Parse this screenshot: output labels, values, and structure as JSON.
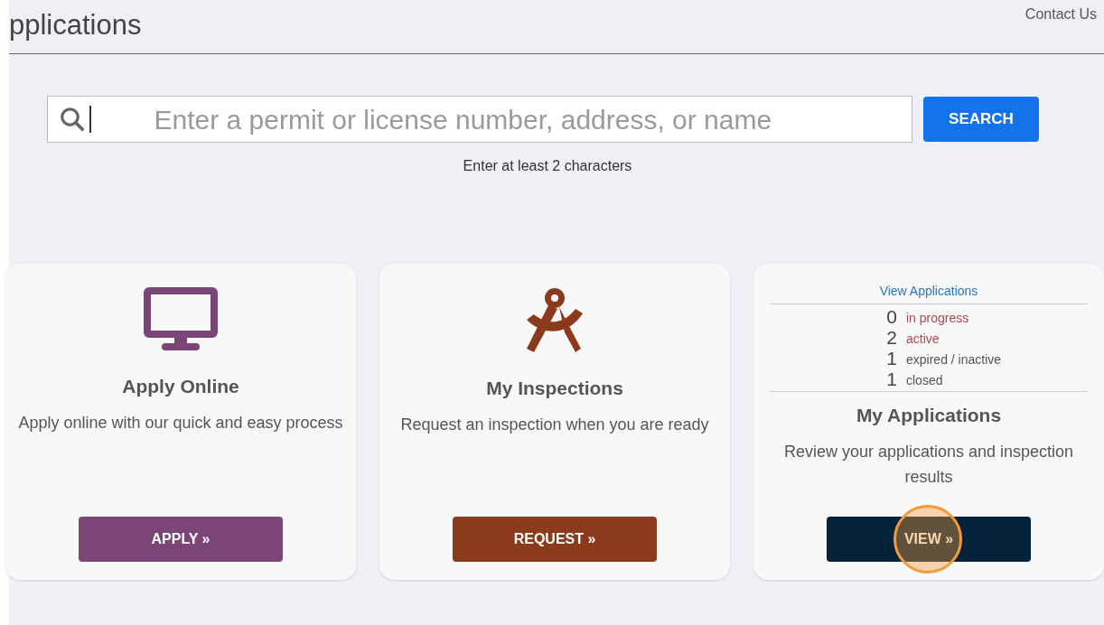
{
  "header": {
    "title": "pplications",
    "contact_link": "Contact Us"
  },
  "search": {
    "placeholder": "Enter a permit or license number, address, or name",
    "button": "SEARCH",
    "hint": "Enter at least 2 characters"
  },
  "cards": [
    {
      "kind": "monitor",
      "color": "#7b4577",
      "title": "Apply Online",
      "description": "Apply online with our quick and easy process",
      "button": "APPLY »",
      "highlighted": false
    },
    {
      "kind": "compass",
      "color": "#8b3a1c",
      "title": "My Inspections",
      "description": "Request an inspection when you are ready",
      "button": "REQUEST »",
      "highlighted": false
    },
    {
      "kind": "stats",
      "color": "#04223a",
      "title": "My Applications",
      "description": "Review your applications and inspection results",
      "button": "VIEW »",
      "highlighted": true,
      "stats_link": "View Applications",
      "stats": [
        {
          "count": "0",
          "label": "in progress",
          "color": "#b0464f"
        },
        {
          "count": "2",
          "label": "active",
          "color": "#b0464f"
        },
        {
          "count": "1",
          "label": "expired / inactive",
          "color": "#555555"
        },
        {
          "count": "1",
          "label": "closed",
          "color": "#555555"
        }
      ]
    }
  ]
}
